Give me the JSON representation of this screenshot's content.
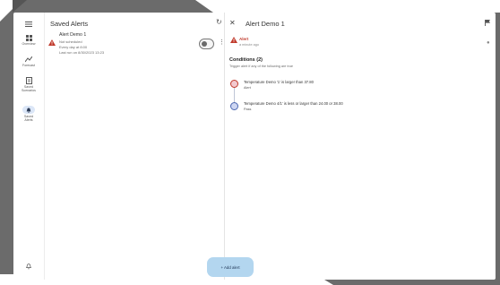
{
  "nav_rail": {
    "items": [
      {
        "label": "Overview",
        "icon": "grid-icon"
      },
      {
        "label": "Forecast",
        "icon": "forecast-icon"
      },
      {
        "label": "Saved\nScenarios",
        "icon": "scenarios-icon"
      },
      {
        "label": "Saved\nAlerts",
        "icon": "bell-icon",
        "selected": true
      }
    ],
    "footer_icon": "bell-outline-icon"
  },
  "list_panel": {
    "title": "Saved Alerts",
    "alerts": [
      {
        "title": "Alert Demo 1",
        "lines": [
          "Not scheduled",
          "Every day at 8:00",
          "Last run on 8/30/2023 13:23"
        ],
        "enabled": false
      }
    ],
    "add_button_label": "+ Add alert"
  },
  "detail_panel": {
    "title": "Alert Demo 1",
    "status_label": "Alert",
    "status_sub": "a minute ago",
    "conditions_title": "Conditions (2)",
    "conditions_sub": "Trigger alert if any of the following are true",
    "conditions": [
      {
        "text": "Temperature Demo '1' is larger than 37.80",
        "state": "Alert",
        "color": "#f2c9cf",
        "stroke": "#c0392b"
      },
      {
        "text": "Temperature Demo 4/1' is less or larger than 24.00 or 38.00",
        "state": "Pass",
        "color": "#cdd6f2",
        "stroke": "#4a66b0"
      }
    ]
  },
  "colors": {
    "accent": "#b3d6ef",
    "alert": "#c0392b",
    "selected_pill": "#dbe6f7"
  }
}
